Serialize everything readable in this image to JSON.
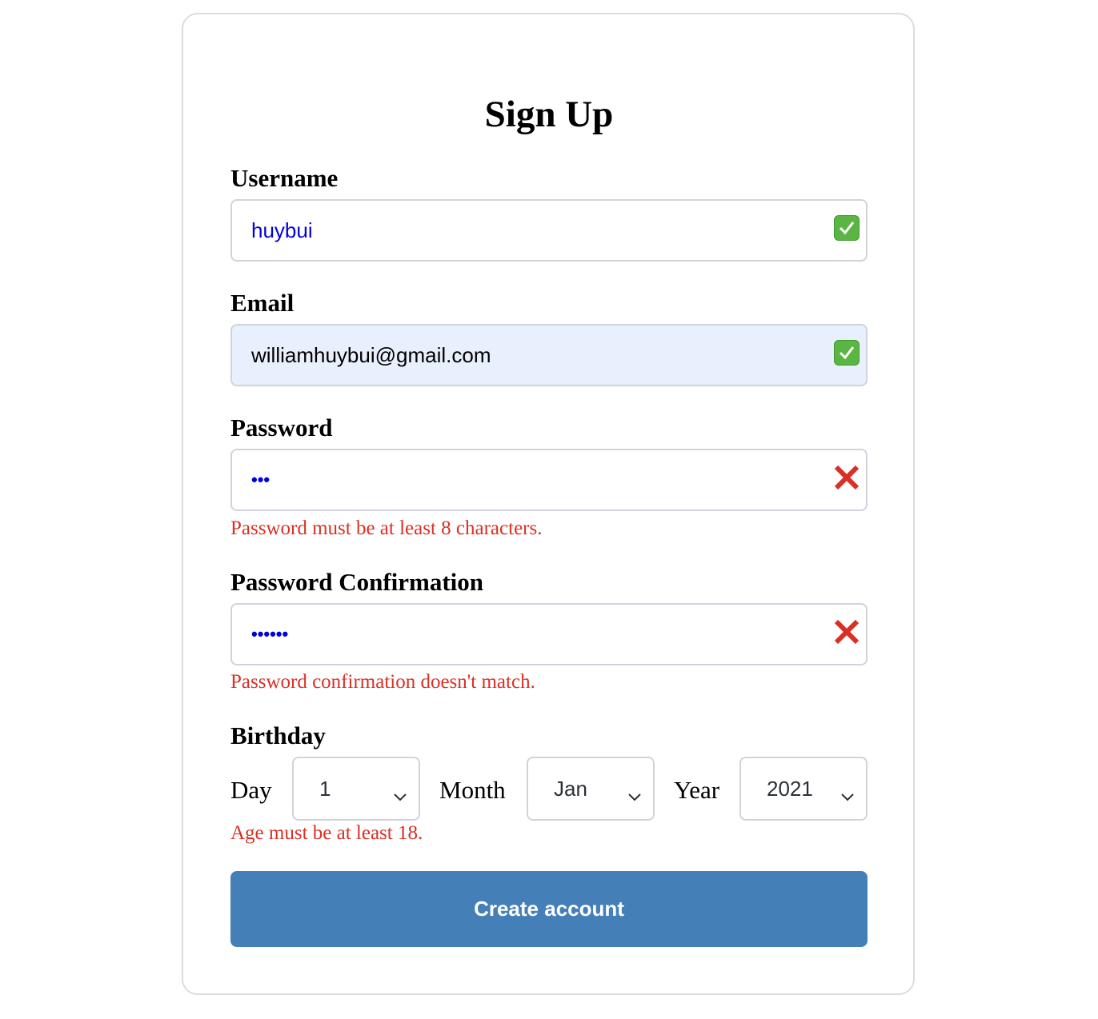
{
  "form": {
    "title": "Sign Up",
    "username": {
      "label": "Username",
      "value": "huybui",
      "status": "valid"
    },
    "email": {
      "label": "Email",
      "value": "williamhuybui@gmail.com",
      "status": "valid"
    },
    "password": {
      "label": "Password",
      "value": "•••",
      "status": "invalid",
      "error": "Password must be at least 8 characters."
    },
    "password_confirmation": {
      "label": "Password Confirmation",
      "value": "••••••",
      "status": "invalid",
      "error": "Password confirmation doesn't match."
    },
    "birthday": {
      "label": "Birthday",
      "day_label": "Day",
      "day_value": "1",
      "month_label": "Month",
      "month_value": "Jan",
      "year_label": "Year",
      "year_value": "2021",
      "error": "Age must be at least 18."
    },
    "submit_label": "Create account"
  },
  "colors": {
    "button": "#4480b7",
    "error": "#d93025",
    "valid": "#5bb543",
    "invalid": "#d93025",
    "autofill_bg": "#e8f0fe"
  },
  "icons": {
    "valid": "check-icon",
    "invalid": "x-icon",
    "select": "chevron-down-icon"
  }
}
